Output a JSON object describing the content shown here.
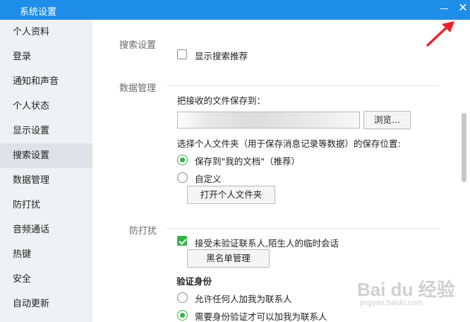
{
  "window": {
    "title": "系统设置",
    "minimize_icon": "minimize-icon",
    "close_icon": "close-icon",
    "close_glyph": "✕"
  },
  "sidebar": {
    "items": [
      {
        "label": "个人资料",
        "active": false
      },
      {
        "label": "登录",
        "active": false
      },
      {
        "label": "通知和声音",
        "active": false
      },
      {
        "label": "个人状态",
        "active": false
      },
      {
        "label": "显示设置",
        "active": false
      },
      {
        "label": "搜索设置",
        "active": true
      },
      {
        "label": "数据管理",
        "active": false
      },
      {
        "label": "防打扰",
        "active": false
      },
      {
        "label": "音频通话",
        "active": false
      },
      {
        "label": "热键",
        "active": false
      },
      {
        "label": "安全",
        "active": false
      },
      {
        "label": "自动更新",
        "active": false
      }
    ]
  },
  "search_settings": {
    "section_title": "搜索设置",
    "show_recommendations": {
      "label": "显示搜索推荐",
      "checked": false
    }
  },
  "data_management": {
    "section_title": "数据管理",
    "save_to_label": "把接收的文件保存到：",
    "save_path_value": "",
    "browse_button": "浏览...",
    "folder_prompt": "选择个人文件夹（用于保存消息记录等数据）的保存位置:",
    "options": [
      {
        "label": "保存到\"我的文档\"（推荐）",
        "checked": true
      },
      {
        "label": "自定义",
        "checked": false
      }
    ],
    "open_folder_button": "打开个人文件夹"
  },
  "do_not_disturb": {
    "section_title": "防打扰",
    "accept_unverified": {
      "label": "接受未验证联系人,陌生人的临时会话",
      "checked": true
    },
    "blacklist_button": "黑名单管理",
    "verify_title": "验证身份",
    "verify_options": [
      {
        "label": "允许任何人加我为联系人",
        "checked": false
      },
      {
        "label": "需要身份验证才可以加我为联系人",
        "checked": true
      }
    ]
  },
  "watermark": {
    "main": "Bai du 经验",
    "sub": "jingyan.baidu.com"
  },
  "colors": {
    "titlebar": "#1e8ee9",
    "accent_green": "#35b34a",
    "sidebar_bg": "#eff1f4",
    "sidebar_active": "#dfe3e8",
    "arrow": "#e8232a"
  }
}
